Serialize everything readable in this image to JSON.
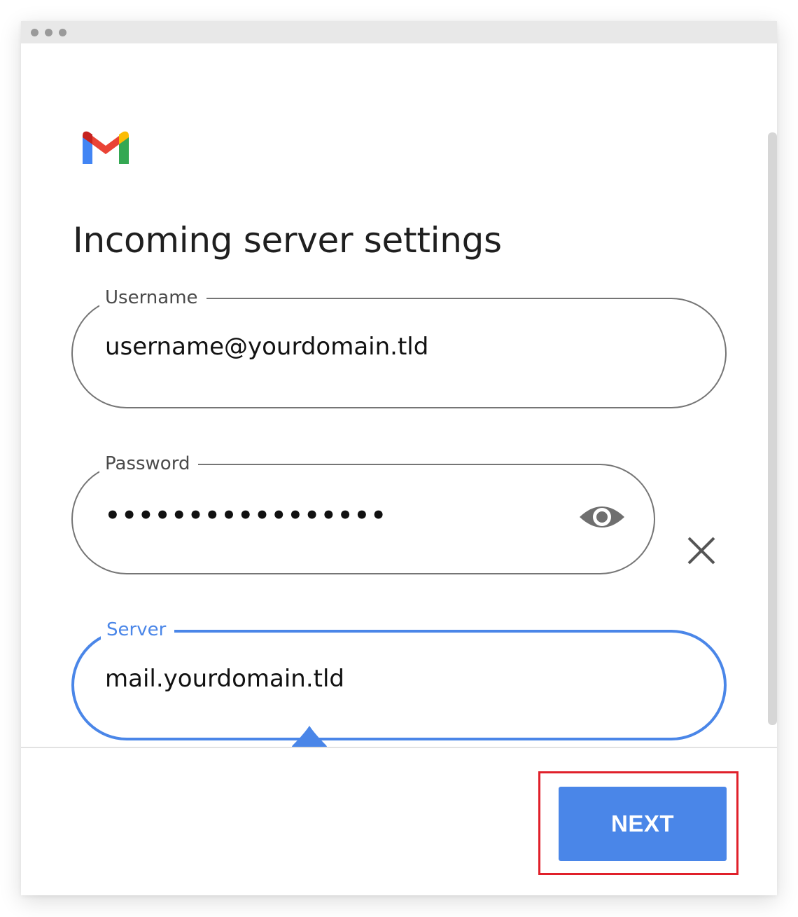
{
  "window": {
    "title_bar_dots": 3
  },
  "logo": {
    "icon": "gmail-logo-icon",
    "colors": [
      "#4285F4",
      "#EA4335",
      "#FBBC04",
      "#34A853",
      "#C5221F"
    ]
  },
  "header": {
    "title": "Incoming server settings"
  },
  "form": {
    "username": {
      "label": "Username",
      "value": "username@yourdomain.tld"
    },
    "password": {
      "label": "Password",
      "value": "•••••••••••••••••",
      "toggle_icon": "eye-icon"
    },
    "clear_icon": "close-icon",
    "server": {
      "label": "Server",
      "value": "mail.yourdomain.tld",
      "focused": true,
      "cursor_handle_icon": "text-cursor-handle-icon"
    }
  },
  "footer": {
    "next_label": "NEXT"
  },
  "colors": {
    "accent": "#4a86e8",
    "border": "#757575",
    "highlight": "#e0202a",
    "title_bar": "#e8e8e8"
  }
}
